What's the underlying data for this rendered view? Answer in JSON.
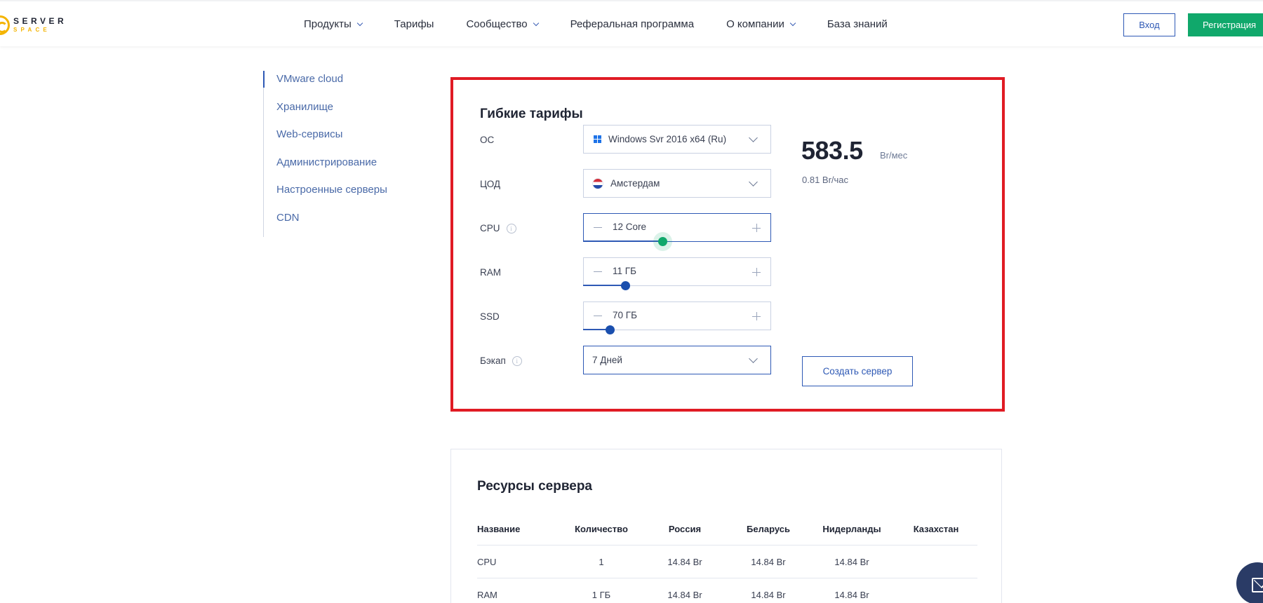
{
  "header": {
    "logo_top": "SERVER",
    "logo_bottom": "SPACE",
    "nav": [
      {
        "label": "Продукты",
        "dropdown": true
      },
      {
        "label": "Тарифы",
        "dropdown": false
      },
      {
        "label": "Сообщество",
        "dropdown": true
      },
      {
        "label": "Реферальная программа",
        "dropdown": false
      },
      {
        "label": "О компании",
        "dropdown": true
      },
      {
        "label": "База знаний",
        "dropdown": false
      }
    ],
    "login_label": "Вход",
    "register_label": "Регистрация"
  },
  "sidebar": {
    "items": [
      {
        "label": "VMware cloud"
      },
      {
        "label": "Хранилище"
      },
      {
        "label": "Web-сервисы"
      },
      {
        "label": "Администрирование"
      },
      {
        "label": "Настроенные серверы"
      },
      {
        "label": "CDN"
      }
    ]
  },
  "config": {
    "title": "Гибкие тарифы",
    "os": {
      "label": "ОС",
      "value": "Windows Svr 2016 x64 (Ru)",
      "icon": "windows-icon"
    },
    "dc": {
      "label": "ЦОД",
      "value": "Амстердам",
      "icon": "netherlands-flag-icon"
    },
    "cpu": {
      "label": "CPU",
      "value": "12 Core",
      "slider_fraction": 0.42
    },
    "ram": {
      "label": "RAM",
      "value": "11 ГБ",
      "slider_fraction": 0.22
    },
    "ssd": {
      "label": "SSD",
      "value": "70 ГБ",
      "slider_fraction": 0.14
    },
    "backup": {
      "label": "Бэкап",
      "value": "7 Дней"
    },
    "price": {
      "amount": "583.5",
      "unit": "Br/мес",
      "hourly": "0.81 Br/час"
    },
    "create_label": "Создать сервер",
    "colors": {
      "accent": "#2e59b5",
      "highlight_border": "#e01b24",
      "green": "#10a86b"
    }
  },
  "resources": {
    "title": "Ресурсы сервера",
    "columns": [
      "Название",
      "Количество",
      "Россия",
      "Беларусь",
      "Нидерланды",
      "Казахстан"
    ],
    "rows": [
      [
        "CPU",
        "1",
        "14.84 Br",
        "14.84 Br",
        "14.84 Br",
        ""
      ],
      [
        "RAM",
        "1 ГБ",
        "14.84 Br",
        "14.84 Br",
        "14.84 Br",
        ""
      ]
    ]
  }
}
